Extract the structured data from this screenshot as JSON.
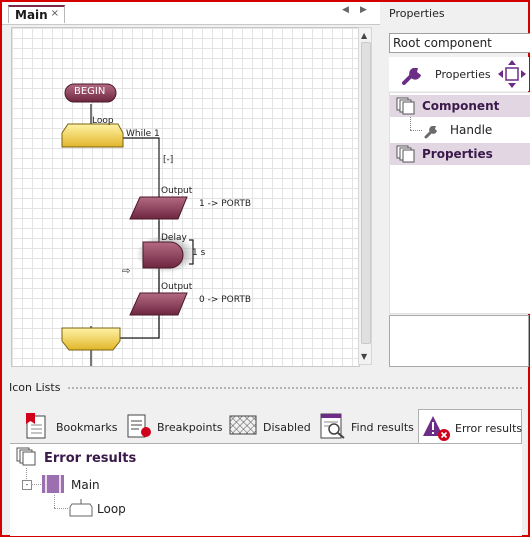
{
  "editor": {
    "tab_label": "Main",
    "close_glyph": "×",
    "prev_glyph": "◀",
    "next_glyph": "▶"
  },
  "flowchart": {
    "begin": "BEGIN",
    "loop_label": "Loop",
    "loop_condition": "While 1",
    "collapse_toggle": "[-]",
    "output1_label": "Output",
    "output1_value": "1 -> PORTB",
    "delay_label": "Delay",
    "delay_value": "1 s",
    "current_marker": "⇨",
    "output2_label": "Output",
    "output2_value": "0 -> PORTB"
  },
  "properties": {
    "title": "Properties",
    "root_select": "Root component",
    "toolbar_label": "Properties",
    "tree": [
      {
        "label": "Component",
        "kind": "group"
      },
      {
        "label": "Handle",
        "kind": "item"
      },
      {
        "label": "Properties",
        "kind": "group"
      }
    ]
  },
  "icon_lists": {
    "title": "Icon Lists",
    "tabs": [
      {
        "label": "Bookmarks",
        "icon": "bookmark-icon"
      },
      {
        "label": "Breakpoints",
        "icon": "breakpoint-icon"
      },
      {
        "label": "Disabled",
        "icon": "disabled-icon"
      },
      {
        "label": "Find results",
        "icon": "find-icon"
      },
      {
        "label": "Error results",
        "icon": "error-icon",
        "active": true
      }
    ],
    "results_title": "Error results",
    "results_tree": [
      {
        "label": "Main",
        "level": 1
      },
      {
        "label": "Loop",
        "level": 2
      }
    ]
  },
  "colors": {
    "frame_border": "#d40000",
    "tab_accent": "#7c2946",
    "shape_fill": "#8d3a54",
    "loop_fill": "#f2d14b",
    "group_row": "#e3d6e3"
  }
}
